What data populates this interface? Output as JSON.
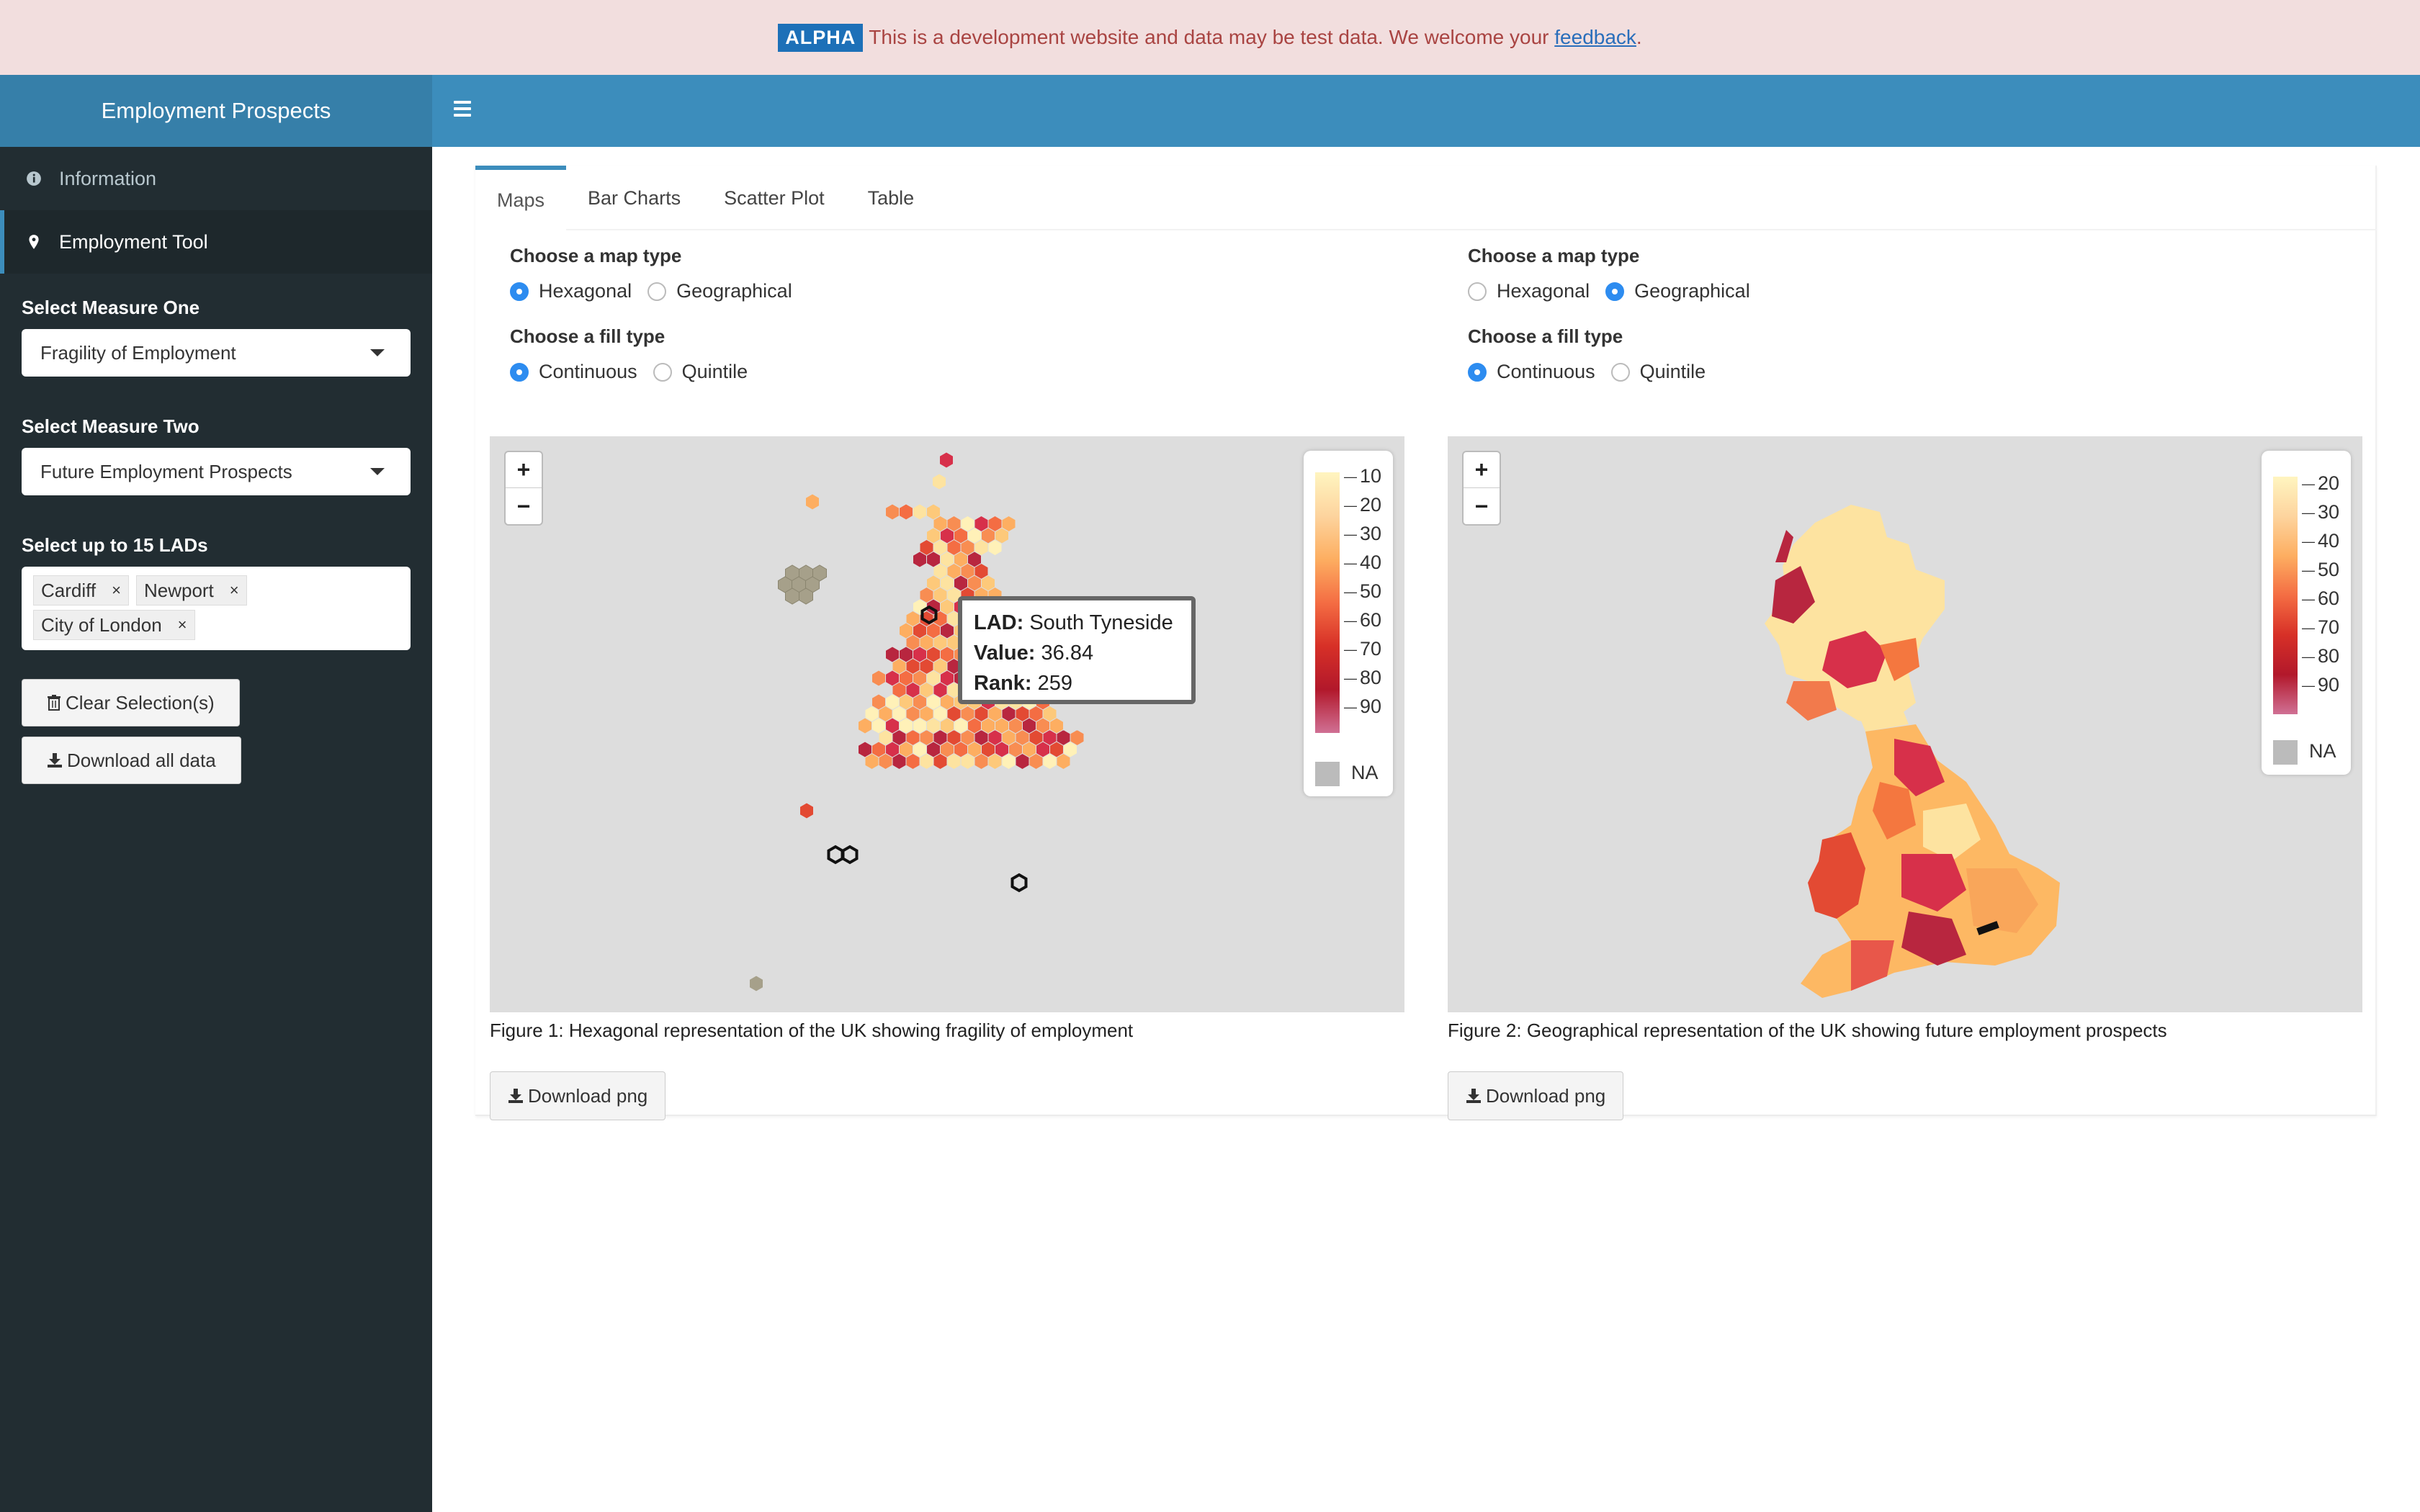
{
  "banner": {
    "badge": "ALPHA",
    "text": "This is a development website and data may be test data. We welcome your",
    "link": "feedback",
    "suffix": "."
  },
  "app": {
    "title": "Employment Prospects"
  },
  "sidebar": {
    "menu": [
      {
        "label": "Information",
        "icon": "info-icon"
      },
      {
        "label": "Employment Tool",
        "icon": "map-marker-icon"
      }
    ],
    "measure_one": {
      "label": "Select Measure One",
      "value": "Fragility of Employment"
    },
    "measure_two": {
      "label": "Select Measure Two",
      "value": "Future Employment Prospects"
    },
    "lads": {
      "label": "Select up to 15 LADs",
      "tags": [
        "Cardiff",
        "Newport",
        "City of London"
      ]
    },
    "clear_button": "Clear Selection(s)",
    "download_button": "Download all data"
  },
  "tabs": [
    "Maps",
    "Bar Charts",
    "Scatter Plot",
    "Table"
  ],
  "left": {
    "map_type_label": "Choose a map type",
    "map_types": [
      "Hexagonal",
      "Geographical"
    ],
    "map_type_selected": "Hexagonal",
    "fill_label": "Choose a fill type",
    "fills": [
      "Continuous",
      "Quintile"
    ],
    "fill_selected": "Continuous",
    "legend": [
      "10",
      "20",
      "30",
      "40",
      "50",
      "60",
      "70",
      "80",
      "90"
    ],
    "na": "NA",
    "tooltip": {
      "lad_label": "LAD:",
      "lad": "South Tyneside",
      "value_label": "Value:",
      "value": "36.84",
      "rank_label": "Rank:",
      "rank": "259"
    },
    "caption": "Figure 1: Hexagonal representation of the UK showing fragility of employment",
    "download": "Download png"
  },
  "right": {
    "map_type_label": "Choose a map type",
    "map_types": [
      "Hexagonal",
      "Geographical"
    ],
    "map_type_selected": "Geographical",
    "fill_label": "Choose a fill type",
    "fills": [
      "Continuous",
      "Quintile"
    ],
    "fill_selected": "Continuous",
    "legend": [
      "20",
      "30",
      "40",
      "50",
      "60",
      "70",
      "80",
      "90"
    ],
    "na": "NA",
    "caption": "Figure 2: Geographical representation of the UK showing future employment prospects",
    "download": "Download png"
  },
  "zoom": {
    "in": "+",
    "out": "−"
  },
  "colors": {
    "header": "#3c8dbc",
    "logo": "#367fa9",
    "sidebar": "#222d32",
    "banner": "#f2dede",
    "radio_on": "#2d8cf0"
  }
}
